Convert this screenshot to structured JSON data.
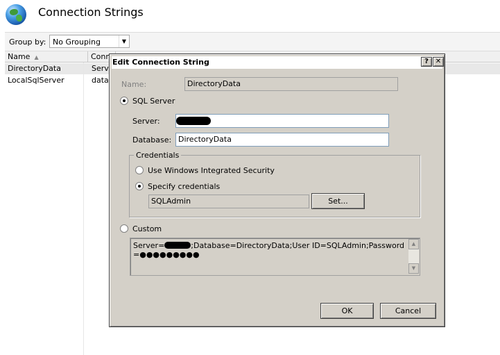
{
  "page": {
    "title": "Connection Strings",
    "group_by_label": "Group by:",
    "group_by_value": "No Grouping",
    "columns": [
      "Name",
      "Conn"
    ],
    "rows": [
      {
        "name": "DirectoryData",
        "conn": "Serve",
        "selected": true
      },
      {
        "name": "LocalSqlServer",
        "conn": "data",
        "selected": false
      }
    ]
  },
  "dialog": {
    "title": "Edit Connection String",
    "help_button": "?",
    "close_button": "✕",
    "name_label": "Name:",
    "name_value": "DirectoryData",
    "sql_server_label": "SQL Server",
    "server_label": "Server:",
    "database_label": "Database:",
    "database_value": "DirectoryData",
    "credentials_title": "Credentials",
    "windows_auth_label": "Use Windows Integrated Security",
    "specify_credentials_label": "Specify credentials",
    "username_value": "SQLAdmin",
    "set_button": "Set...",
    "custom_label": "Custom",
    "custom_text_before": "Server=",
    "custom_text_after": ";Database=DirectoryData;User ID=SQLAdmin;Password=●●●●●●●●●",
    "ok_button": "OK",
    "cancel_button": "Cancel"
  }
}
